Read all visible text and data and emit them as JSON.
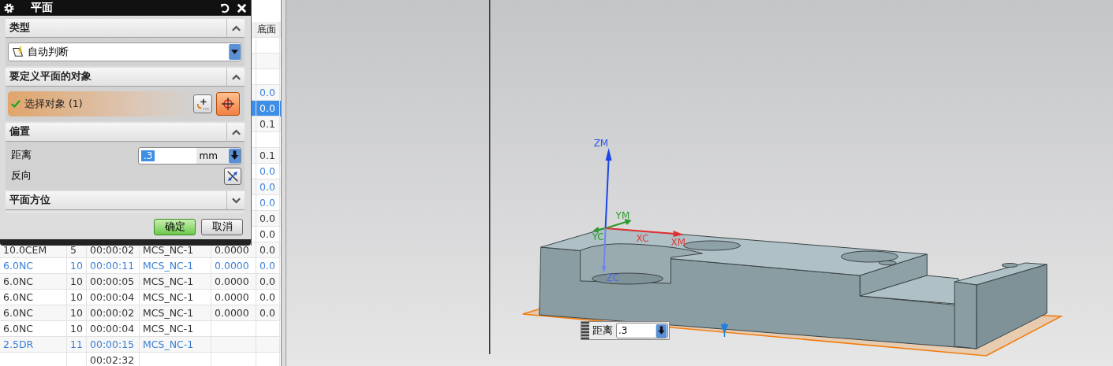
{
  "dialog": {
    "title": "平面",
    "sections": [
      {
        "kind": "type",
        "title": "类型",
        "expanded": true,
        "dropdown_value": "自动判断"
      },
      {
        "kind": "objects",
        "title": "要定义平面的对象",
        "expanded": true,
        "select_label": "选择对象 (1)",
        "select_done": true,
        "pick_tool_selected": true
      },
      {
        "kind": "offset",
        "title": "偏置",
        "expanded": true,
        "distance_label": "距离",
        "distance_value": ".3",
        "value_highlighted": true,
        "unit": "mm",
        "reverse_label": "反向"
      },
      {
        "kind": "orientation",
        "title": "平面方位",
        "expanded": false
      }
    ],
    "buttons": [
      {
        "label": "确定",
        "default": true
      },
      {
        "label": "取消",
        "default": false
      }
    ]
  },
  "table": {
    "column_6_header": "底面",
    "rows": [
      {
        "selected": false
      },
      {
        "selected": false
      },
      {
        "selected": false
      },
      {
        "selected": false,
        "color": "#3b7fd4",
        "column_6": "0.0"
      },
      {
        "selected": true,
        "column_6": "0.0"
      },
      {
        "selected": false,
        "color": "#333333",
        "column_6": "0.1"
      },
      {
        "selected": false
      },
      {
        "selected": false,
        "color": "#333333",
        "column_6": "0.1"
      },
      {
        "selected": false,
        "color": "#3b7fd4",
        "column_6": "0.0"
      },
      {
        "selected": false,
        "color": "#3b7fd4",
        "column_6": "0.0"
      },
      {
        "selected": false,
        "color": "#3b7fd4",
        "column_6": "0.0"
      },
      {
        "selected": false,
        "color": "#333333",
        "column_6": "0.0"
      },
      {
        "selected": false,
        "color": "#333333",
        "column_6": "0.0"
      },
      {
        "selected": false,
        "color": "#333333",
        "column_1": "10.0CEM",
        "column_2": "5",
        "column_3": "00:00:02",
        "column_4": "MCS_NC-1",
        "column_5": "0.0000",
        "column_6": "0.0"
      },
      {
        "selected": false,
        "color": "#3b7fd4",
        "column_1": "6.0NC",
        "column_2": "10",
        "column_3": "00:00:11",
        "column_4": "MCS_NC-1",
        "column_5": "0.0000",
        "column_6": "0.0"
      },
      {
        "selected": false,
        "color": "#333333",
        "column_1": "6.0NC",
        "column_2": "10",
        "column_3": "00:00:05",
        "column_4": "MCS_NC-1",
        "column_5": "0.0000",
        "column_6": "0.0"
      },
      {
        "selected": false,
        "color": "#333333",
        "column_1": "6.0NC",
        "column_2": "10",
        "column_3": "00:00:04",
        "column_4": "MCS_NC-1",
        "column_5": "0.0000",
        "column_6": "0.0"
      },
      {
        "selected": false,
        "color": "#333333",
        "column_1": "6.0NC",
        "column_2": "10",
        "column_3": "00:00:02",
        "column_4": "MCS_NC-1",
        "column_5": "0.0000",
        "column_6": "0.0"
      },
      {
        "selected": false,
        "color": "#333333",
        "column_1": "6.0NC",
        "column_2": "10",
        "column_3": "00:00:04",
        "column_4": "MCS_NC-1"
      },
      {
        "selected": false,
        "color": "#3b7fd4",
        "column_1": "2.5DR",
        "column_2": "11",
        "column_3": "00:00:15",
        "column_4": "MCS_NC-1"
      },
      {
        "selected": false,
        "color": "#333333",
        "column_3": "00:02:32"
      }
    ]
  },
  "viewport": {
    "axis_labels": [
      {
        "label": "ZM",
        "color": "#2a55e8"
      },
      {
        "label": "YM",
        "color": "#2f9a2f"
      },
      {
        "label": "YC",
        "color": "#2f9a2f"
      },
      {
        "label": "XC",
        "color": "#e03a3a"
      },
      {
        "label": "XM",
        "color": "#e03a3a"
      },
      {
        "label": "ZC",
        "color": "#4a6cf0"
      }
    ],
    "distance_box": {
      "label": "距离",
      "value": ".3"
    }
  }
}
